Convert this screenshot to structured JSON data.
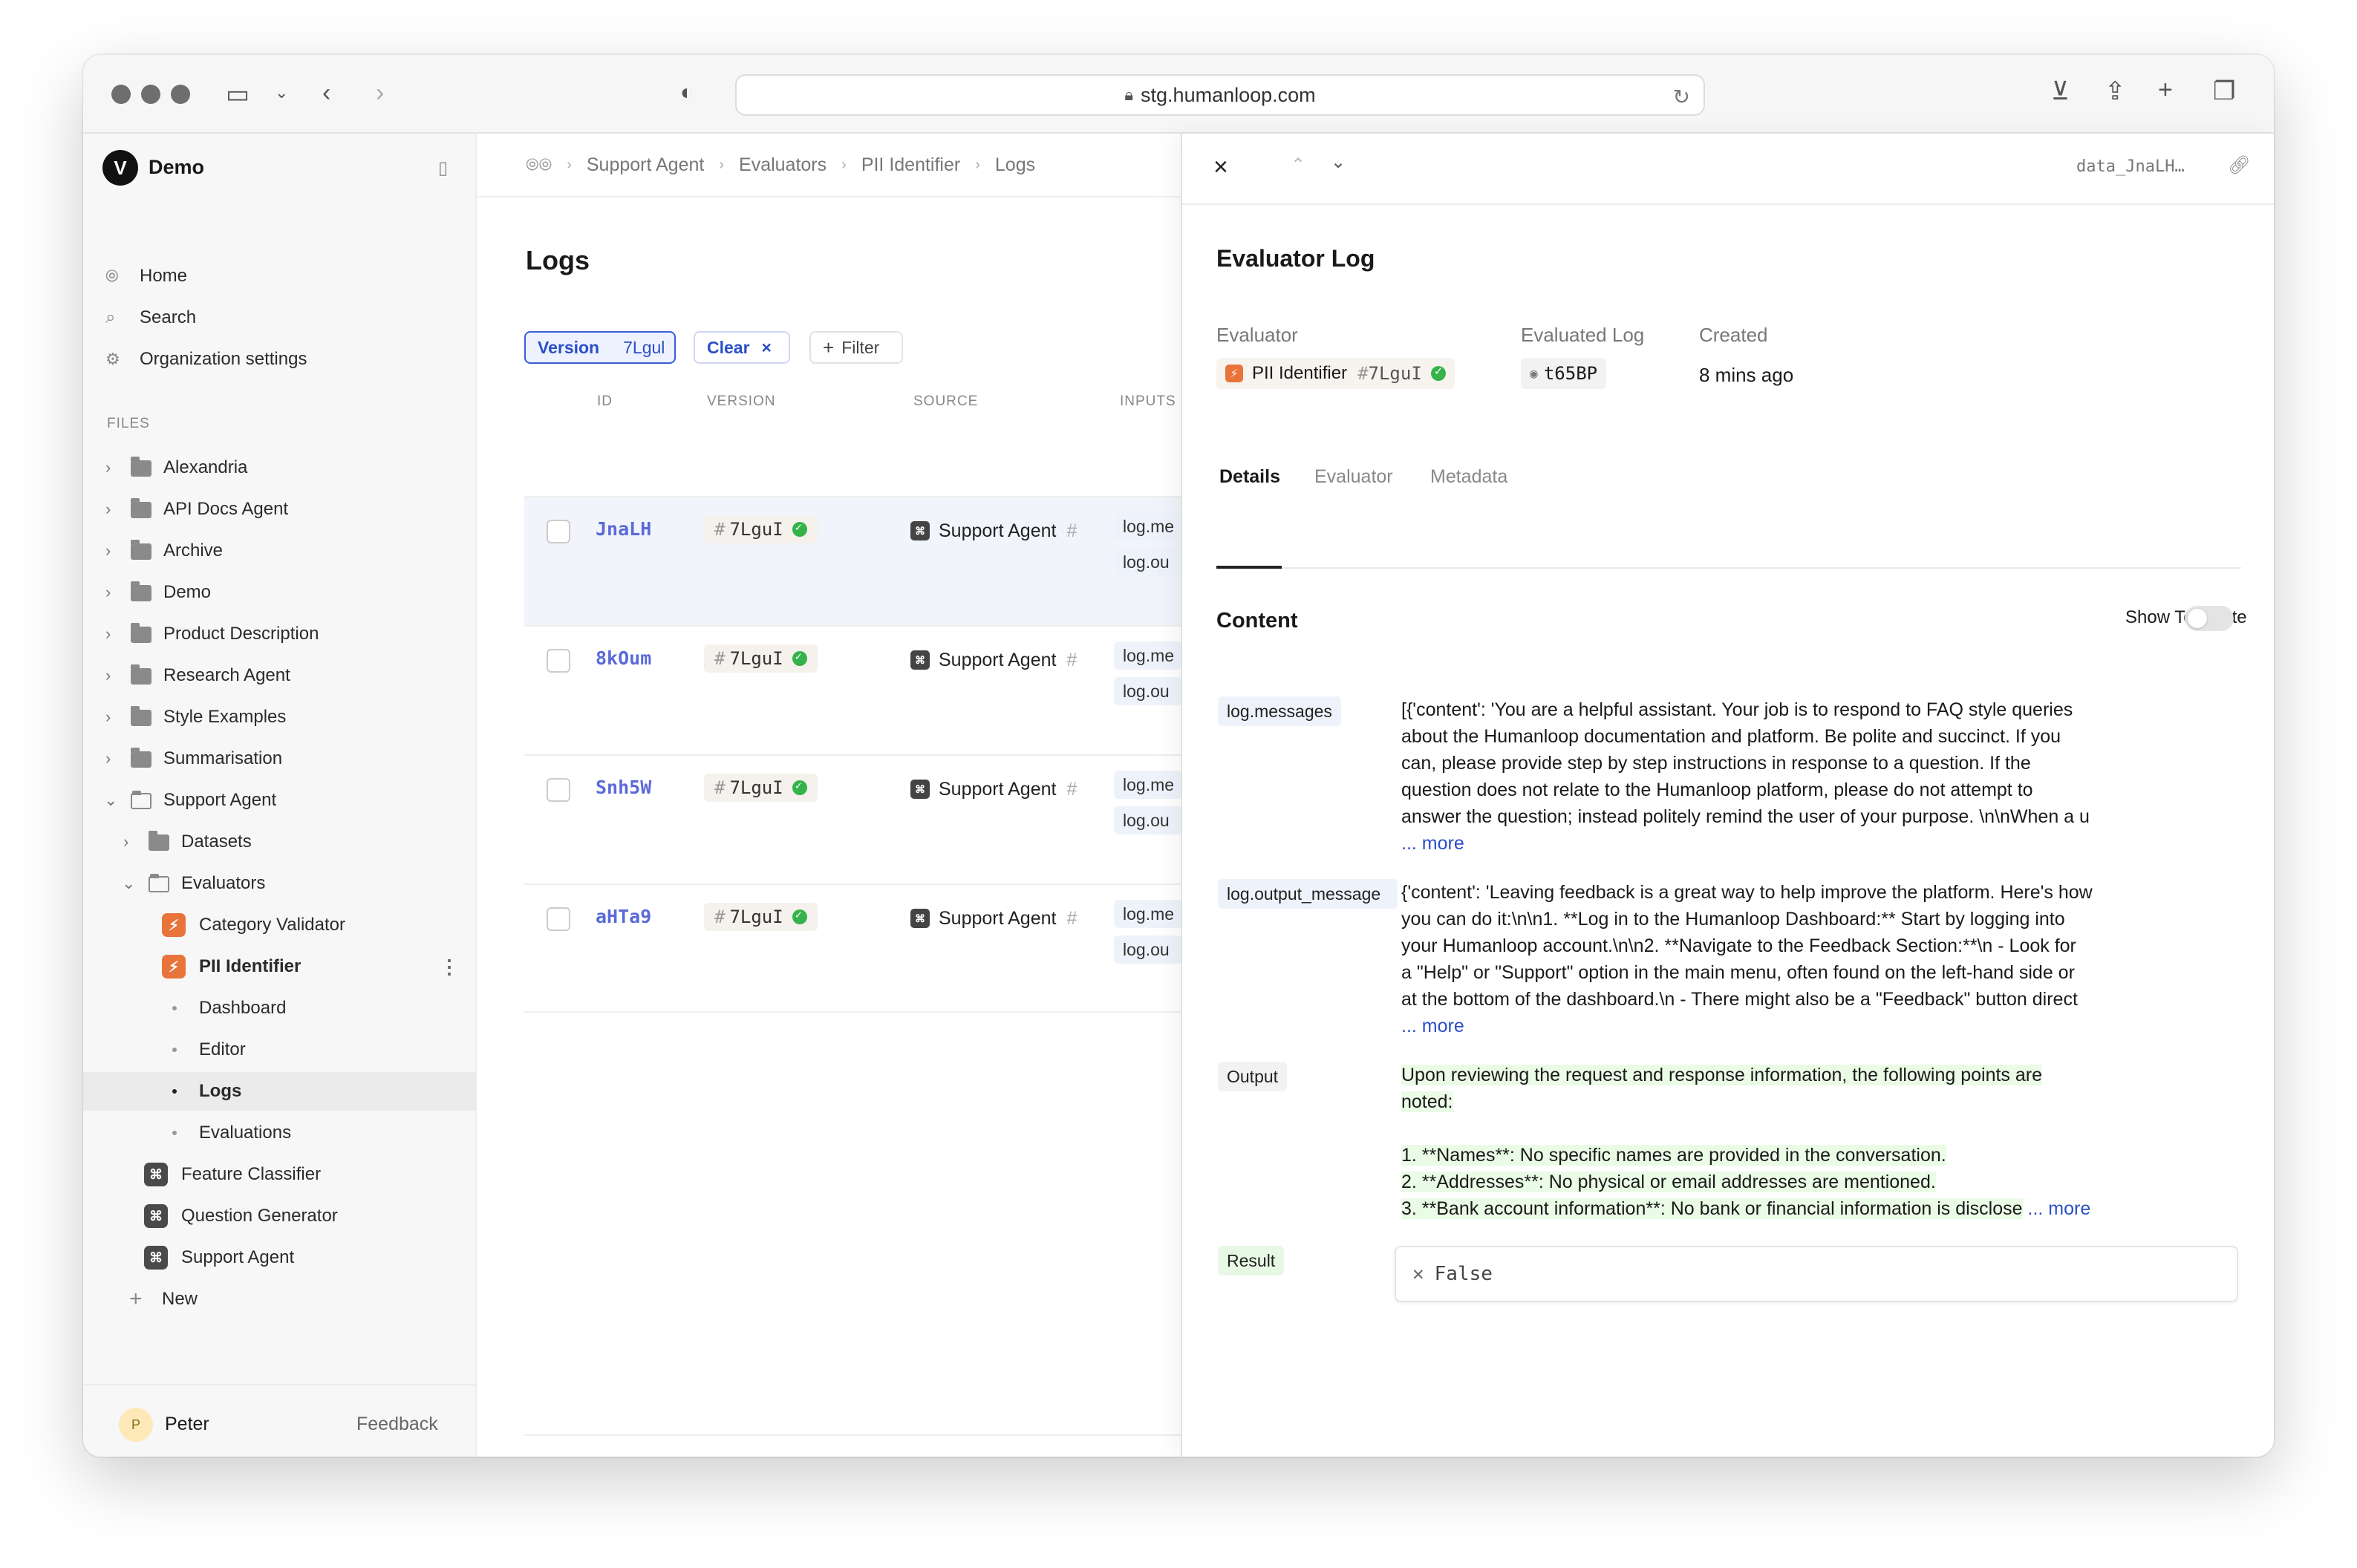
{
  "browser": {
    "url": "stg.humanloop.com"
  },
  "sidebar": {
    "org_name": "Demo",
    "nav": [
      "Home",
      "Search",
      "Organization settings"
    ],
    "files_heading": "FILES",
    "folders": [
      "Alexandria",
      "API Docs Agent",
      "Archive",
      "Demo",
      "Product Description",
      "Research Agent",
      "Style Examples",
      "Summarisation",
      "Support Agent"
    ],
    "support_children": {
      "datasets": "Datasets",
      "evaluators": "Evaluators",
      "evaluator_items": [
        "Category Validator",
        "PII Identifier"
      ],
      "pii_sub": [
        "Dashboard",
        "Editor",
        "Logs",
        "Evaluations"
      ],
      "agents": [
        "Feature Classifier",
        "Question Generator",
        "Support Agent"
      ]
    },
    "new_label": "New",
    "user": {
      "initial": "P",
      "name": "Peter"
    },
    "feedback_label": "Feedback"
  },
  "main": {
    "breadcrumb": [
      "Support Agent",
      "Evaluators",
      "PII Identifier",
      "Logs"
    ],
    "title": "Logs",
    "filters": {
      "version_label": "Version",
      "version_value": "7Lgul",
      "clear_label": "Clear",
      "filter_label": "Filter"
    },
    "columns": [
      "ID",
      "VERSION",
      "SOURCE",
      "INPUTS"
    ],
    "rows": [
      {
        "id": "JnaLH",
        "version": "7LguI",
        "source": "Support Agent",
        "inputs": [
          "log.me",
          "log.ou"
        ]
      },
      {
        "id": "8kOum",
        "version": "7LguI",
        "source": "Support Agent",
        "inputs": [
          "log.me",
          "log.ou"
        ]
      },
      {
        "id": "Snh5W",
        "version": "7LguI",
        "source": "Support Agent",
        "inputs": [
          "log.me",
          "log.ou"
        ]
      },
      {
        "id": "aHTa9",
        "version": "7LguI",
        "source": "Support Agent",
        "inputs": [
          "log.me",
          "log.ou"
        ]
      }
    ]
  },
  "drawer": {
    "log_ref": "data_JnaLH…",
    "title": "Evaluator Log",
    "evaluator_label": "Evaluator",
    "evaluator_name": "PII Identifier",
    "evaluator_version": "7LguI",
    "evaluated_log_label": "Evaluated Log",
    "evaluated_log_value": "t65BP",
    "created_label": "Created",
    "created_value": "8 mins ago",
    "tabs": [
      "Details",
      "Evaluator",
      "Metadata"
    ],
    "content_heading": "Content",
    "show_template_label": "Show Template",
    "messages_key": "log.messages",
    "messages_lines": [
      "[{'content': 'You are a helpful assistant. Your job is to respond to FAQ style queries",
      "about the Humanloop documentation and platform. Be polite and succinct. If you",
      "can, please provide step by step instructions in response to a question. If the",
      "question does not relate to the Humanloop platform, please do not attempt to",
      "answer the question; instead politely remind the user of your purpose. \\n\\nWhen a u"
    ],
    "output_message_key": "log.output_message",
    "output_message_lines": [
      "{'content': 'Leaving feedback is a great way to help improve the platform. Here's how",
      "you can do it:\\n\\n1. **Log in to the Humanloop Dashboard:** Start by logging into",
      "your Humanloop account.\\n\\n2. **Navigate to the Feedback Section:**\\n   - Look for",
      "a \"Help\" or \"Support\" option in the main menu, often found on the left-hand side or",
      "at the bottom of the dashboard.\\n   - There might also be a \"Feedback\" button direct"
    ],
    "more_label": "... more",
    "output_key": "Output",
    "output_lines": [
      "Upon reviewing the request and response information, the following points are",
      "noted:",
      "1. **Names**: No specific names are provided in the conversation.",
      "2. **Addresses**: No physical or email addresses are mentioned.",
      "3. **Bank account information**: No bank or financial information is disclose"
    ],
    "result_key": "Result",
    "result_value": "False"
  },
  "colors": {
    "accent": "#2a4fc7",
    "evaluator_icon": "#e8743b",
    "success": "#34b34a",
    "highlight": "#eafbe6"
  }
}
